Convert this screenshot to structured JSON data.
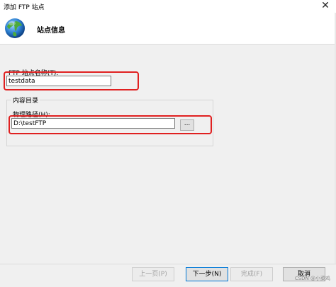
{
  "window": {
    "title": "添加 FTP 站点",
    "close_symbol": "✕"
  },
  "header": {
    "title": "站点信息"
  },
  "form": {
    "site_name_label": "FTP 站点名称(T):",
    "site_name_value": "testdata",
    "content_group_label": "内容目录",
    "physical_path_label": "物理路径(H):",
    "physical_path_value": "D:\\testFTP",
    "browse_label": "..."
  },
  "buttons": {
    "previous": "上一页(P)",
    "next": "下一步(N)",
    "finish": "完成(F)",
    "cancel": "取消"
  },
  "colors": {
    "highlight": "#e02020",
    "primary_border": "#0078d7"
  },
  "watermark": "CSDN @小菜鸡"
}
